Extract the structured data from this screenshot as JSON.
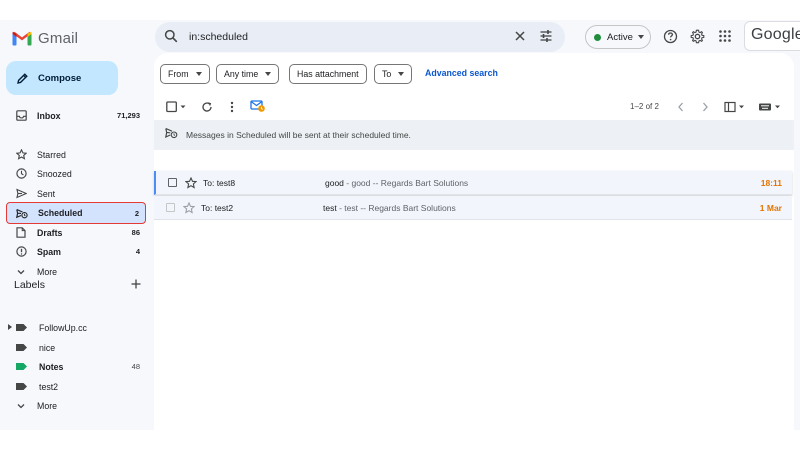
{
  "app": {
    "name": "Gmail"
  },
  "search": {
    "query": "in:scheduled"
  },
  "status": {
    "label": "Active"
  },
  "google": {
    "text": "Google"
  },
  "compose": {
    "label": "Compose"
  },
  "sidebar": {
    "items": [
      {
        "label": "Inbox",
        "count": "71,293",
        "icon": "inbox-icon"
      },
      {
        "label": "Starred",
        "count": "",
        "icon": "star-icon"
      },
      {
        "label": "Snoozed",
        "count": "",
        "icon": "clock-icon"
      },
      {
        "label": "Sent",
        "count": "",
        "icon": "send-icon"
      },
      {
        "label": "Scheduled",
        "count": "2",
        "icon": "scheduled-send-icon"
      },
      {
        "label": "Drafts",
        "count": "86",
        "icon": "draft-icon"
      },
      {
        "label": "Spam",
        "count": "4",
        "icon": "spam-icon"
      },
      {
        "label": "More",
        "count": "",
        "icon": "chevron-down-icon"
      }
    ]
  },
  "labels": {
    "title": "Labels",
    "items": [
      {
        "label": "FollowUp.cc",
        "count": "",
        "color": "#444746"
      },
      {
        "label": "nice",
        "count": "",
        "color": "#444746"
      },
      {
        "label": "Notes",
        "count": "48",
        "color": "#16a765"
      },
      {
        "label": "test2",
        "count": "",
        "color": "#444746"
      }
    ],
    "more": "More"
  },
  "filters": {
    "from": "From",
    "any_time": "Any time",
    "has_attachment": "Has attachment",
    "to": "To",
    "advanced": "Advanced search"
  },
  "toolbar": {
    "pager": "1–2 of 2"
  },
  "notice": {
    "text": "Messages in Scheduled will be sent at their scheduled time."
  },
  "emails": [
    {
      "to": "To: test8",
      "subject": "good",
      "snippet": " - good -- Regards Bart Solutions",
      "time": "18:11"
    },
    {
      "to": "To: test2",
      "subject": "test",
      "snippet": " - test -- Regards Bart Solutions",
      "time": "1 Mar"
    }
  ],
  "colors": {
    "accent": "#0b57d0",
    "compose_bg": "#c2e7ff",
    "selected_bg": "#d3e3fd",
    "highlight_box": "#e53935",
    "time_orange": "#e37400"
  }
}
